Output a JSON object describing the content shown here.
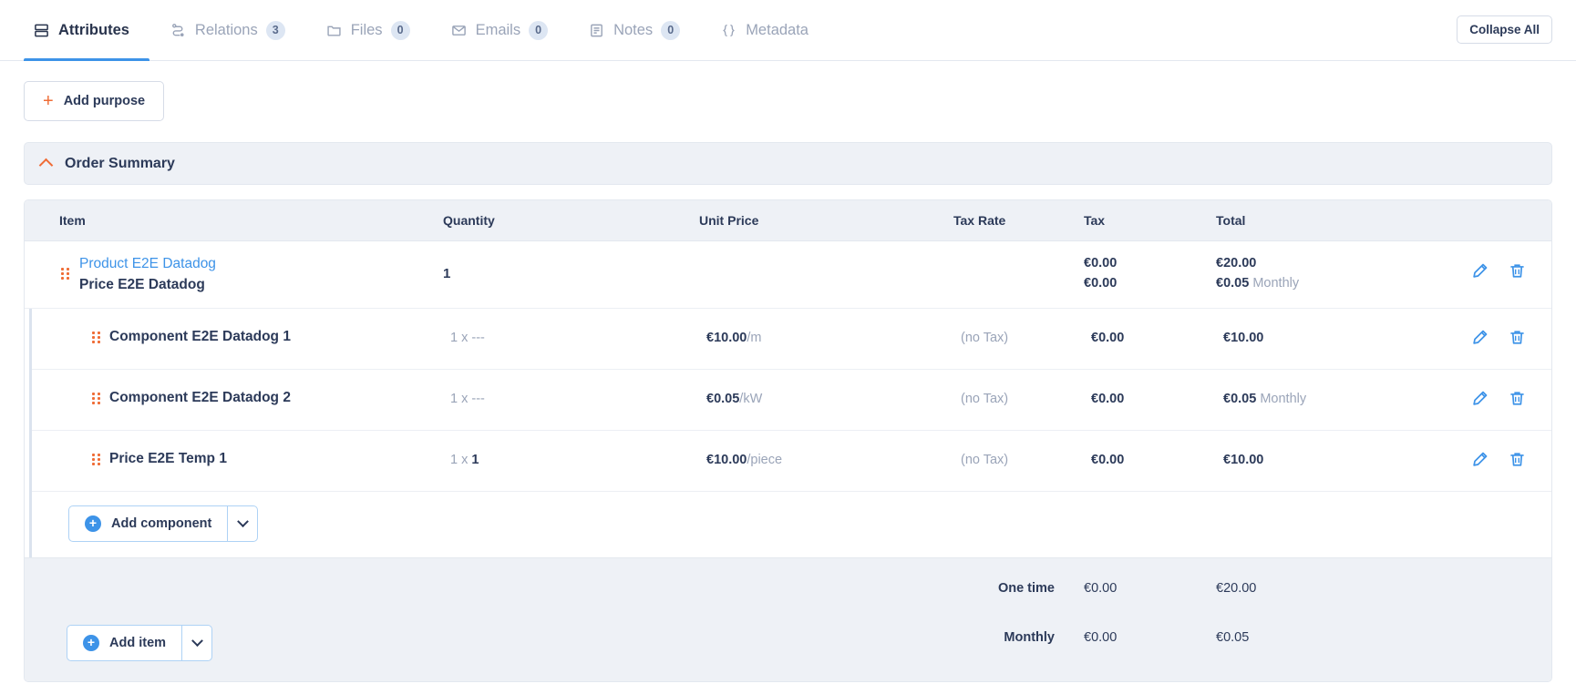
{
  "tabs": [
    {
      "label": "Attributes",
      "icon": "attributes-icon",
      "badge": null,
      "active": true
    },
    {
      "label": "Relations",
      "icon": "relations-icon",
      "badge": "3",
      "active": false
    },
    {
      "label": "Files",
      "icon": "folder-icon",
      "badge": "0",
      "active": false
    },
    {
      "label": "Emails",
      "icon": "envelope-icon",
      "badge": "0",
      "active": false
    },
    {
      "label": "Notes",
      "icon": "note-icon",
      "badge": "0",
      "active": false
    },
    {
      "label": "Metadata",
      "icon": "braces-icon",
      "badge": null,
      "active": false
    }
  ],
  "toolbar": {
    "collapse_all_label": "Collapse All",
    "add_purpose_label": "Add purpose"
  },
  "panel": {
    "title": "Order Summary",
    "expanded": true
  },
  "table": {
    "headers": {
      "item": "Item",
      "quantity": "Quantity",
      "unit_price": "Unit Price",
      "tax_rate": "Tax Rate",
      "tax": "Tax",
      "total": "Total"
    },
    "product_row": {
      "link_label": "Product E2E Datadog",
      "sub_label": "Price E2E Datadog",
      "quantity": "1",
      "unit_price": "",
      "tax_rate": "",
      "tax_line1": "€0.00",
      "tax_line2": "€0.00",
      "total_line1": "€20.00",
      "total_line2_amount": "€0.05",
      "total_line2_period": "Monthly"
    },
    "components": [
      {
        "name": "Component E2E Datadog 1",
        "qty_prefix": "1 x",
        "qty_value": "---",
        "qty_value_bold": false,
        "unit_price_amount": "€10.00",
        "unit_price_unit": "/m",
        "tax_rate": "(no Tax)",
        "tax": "€0.00",
        "total_amount": "€10.00",
        "total_period": ""
      },
      {
        "name": "Component E2E Datadog 2",
        "qty_prefix": "1 x",
        "qty_value": "---",
        "qty_value_bold": false,
        "unit_price_amount": "€0.05",
        "unit_price_unit": "/kW",
        "tax_rate": "(no Tax)",
        "tax": "€0.00",
        "total_amount": "€0.05",
        "total_period": "Monthly"
      },
      {
        "name": "Price E2E Temp 1",
        "qty_prefix": "1 x",
        "qty_value": "1",
        "qty_value_bold": true,
        "unit_price_amount": "€10.00",
        "unit_price_unit": "/piece",
        "tax_rate": "(no Tax)",
        "tax": "€0.00",
        "total_amount": "€10.00",
        "total_period": ""
      }
    ],
    "add_component_label": "Add component",
    "add_item_label": "Add item",
    "totals": [
      {
        "label": "One time",
        "tax": "€0.00",
        "total": "€20.00"
      },
      {
        "label": "Monthly",
        "tax": "€0.00",
        "total": "€0.05"
      }
    ]
  },
  "colors": {
    "accent_orange": "#ef6c35",
    "accent_blue": "#3d93e8",
    "text_dark": "#2c3a59",
    "text_muted": "#9aa4b8",
    "panel_bg": "#eef1f6",
    "border": "#e3e8ef"
  }
}
